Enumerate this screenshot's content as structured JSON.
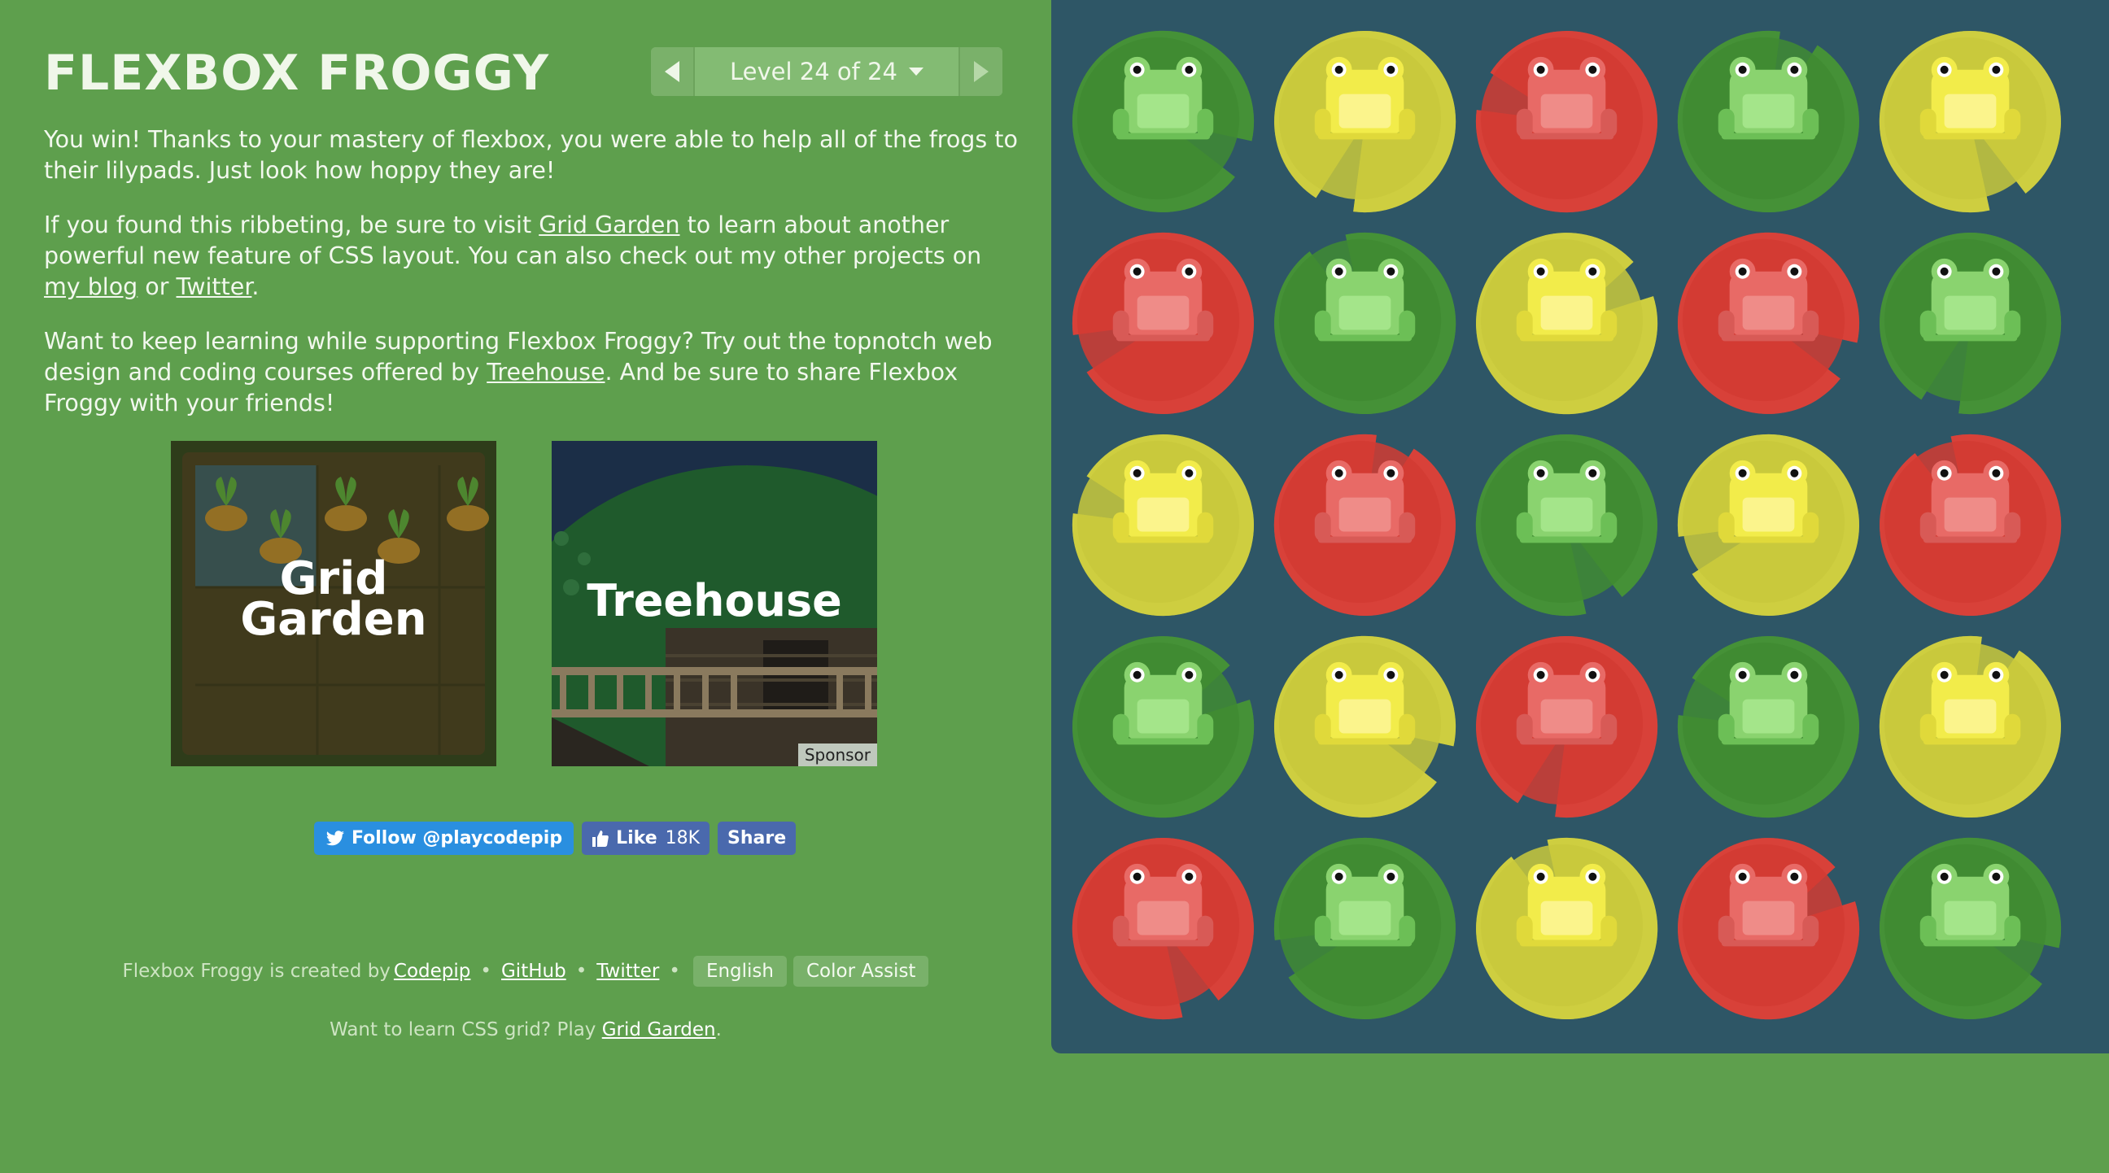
{
  "header": {
    "title": "Flexbox Froggy",
    "level_label": "Level 24 of 24"
  },
  "instructions": {
    "p1": "You win! Thanks to your mastery of flexbox, you were able to help all of the frogs to their lilypads. Just look how hoppy they are!",
    "p2_a": "If you found this ribbeting, be sure to visit ",
    "p2_link1": "Grid Garden",
    "p2_b": " to learn about another powerful new feature of CSS layout. You can also check out my other projects on ",
    "p2_link2": "my blog",
    "p2_c": " or ",
    "p2_link3": "Twitter",
    "p2_d": ".",
    "p3_a": "Want to keep learning while supporting Flexbox Froggy? Try out the topnotch web design and coding courses offered by ",
    "p3_link": "Treehouse",
    "p3_b": ". And be sure to share Flexbox Froggy with your friends!"
  },
  "promos": {
    "grid_garden_line1": "Grid",
    "grid_garden_line2": "Garden",
    "treehouse": "Treehouse",
    "sponsor": "Sponsor"
  },
  "social": {
    "twitter": "Follow @playcodepip",
    "fb_like": "Like",
    "fb_count": "18K",
    "fb_share": "Share"
  },
  "footer": {
    "created_by": "Flexbox Froggy is created by",
    "codepip": "Codepip",
    "github": "GitHub",
    "twitter": "Twitter",
    "language": "English",
    "color_assist": "Color Assist",
    "learn_prefix": "Want to learn CSS grid? Play ",
    "grid_garden": "Grid Garden",
    "learn_suffix": "."
  },
  "colors": {
    "background": "#5e9f4d",
    "pond": "#2e5666",
    "green_pad": "#3f8b32",
    "yellow_pad": "#c9c93c",
    "red_pad": "#d23b33"
  },
  "board": {
    "rows": [
      [
        "green",
        "yellow",
        "red",
        "green",
        "yellow"
      ],
      [
        "red",
        "green",
        "yellow",
        "red",
        "green"
      ],
      [
        "yellow",
        "red",
        "green",
        "yellow",
        "red"
      ],
      [
        "green",
        "yellow",
        "red",
        "green",
        "yellow"
      ],
      [
        "red",
        "green",
        "yellow",
        "red",
        "green"
      ]
    ]
  }
}
